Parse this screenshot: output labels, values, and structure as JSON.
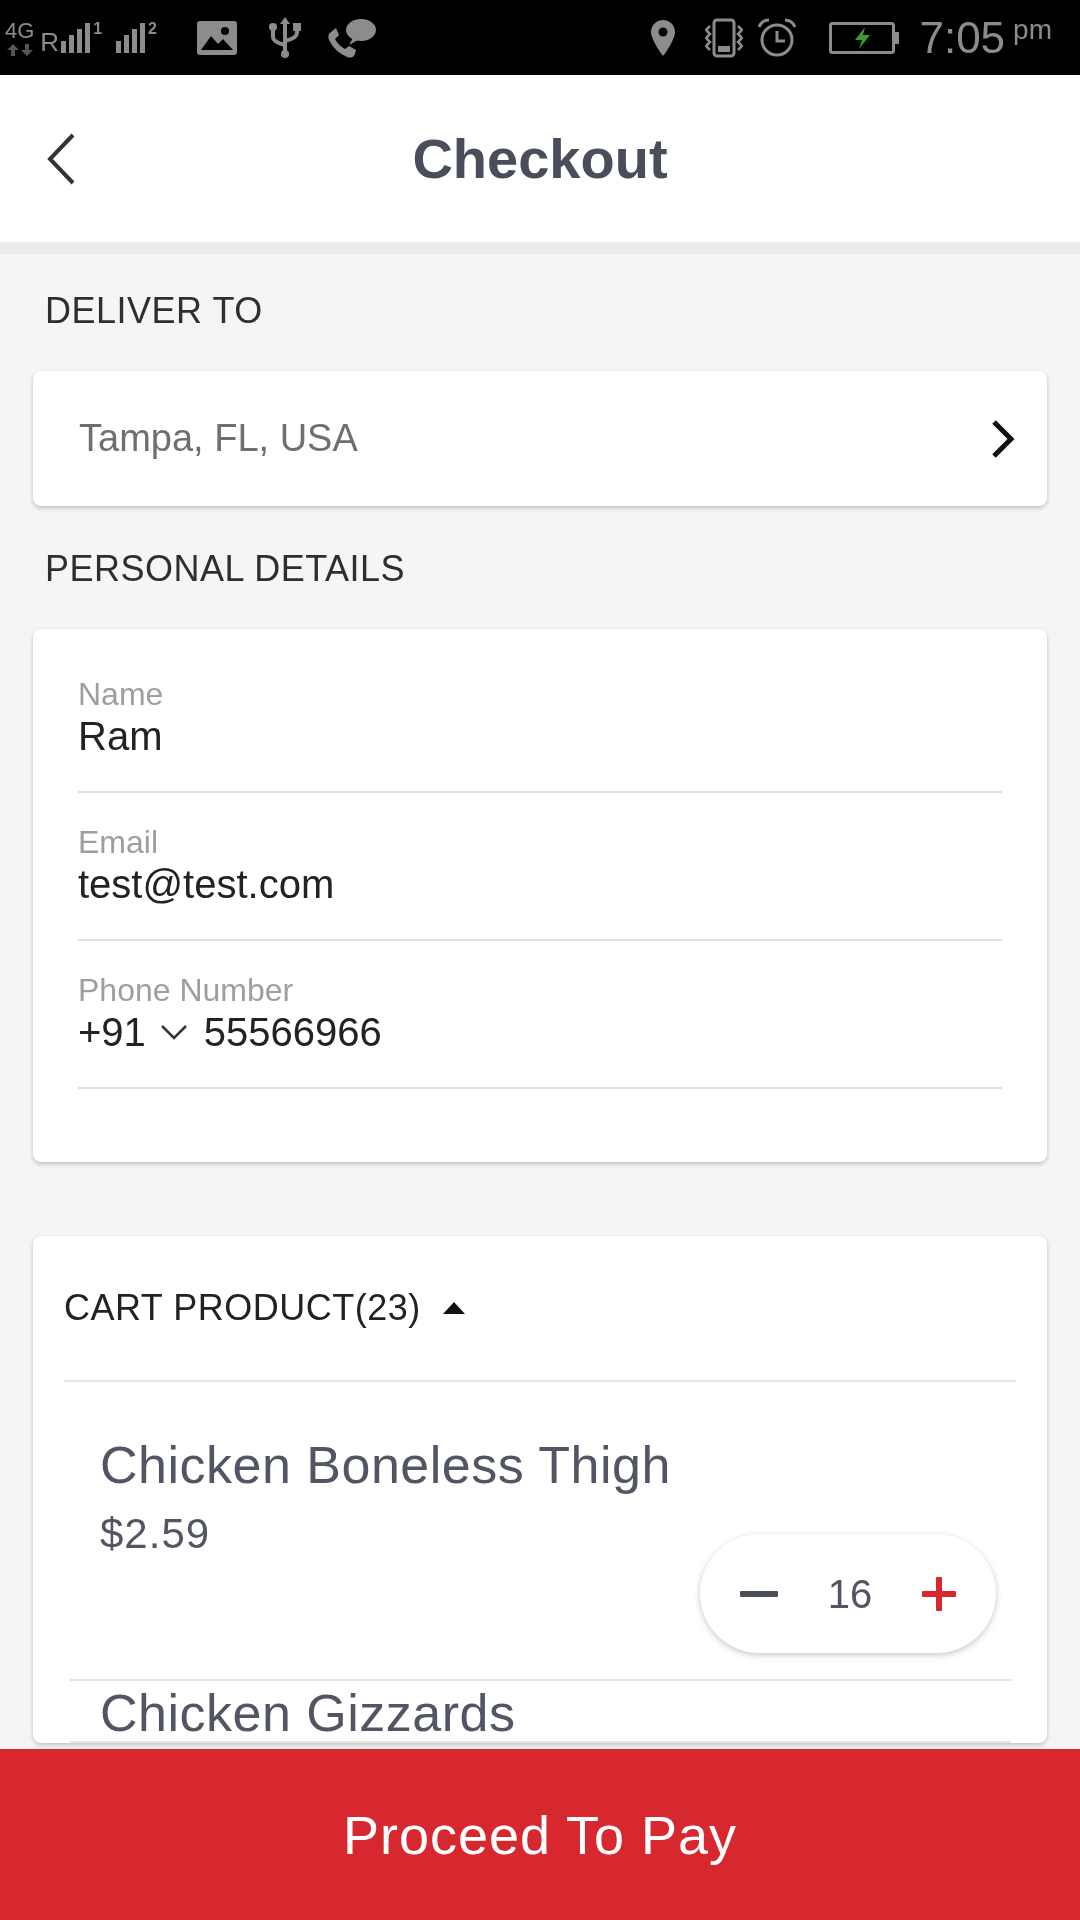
{
  "status_bar": {
    "network": "4G",
    "roaming": "R",
    "sim_slots": [
      "1",
      "2"
    ],
    "time": "7:05",
    "period": "pm"
  },
  "header": {
    "title": "Checkout"
  },
  "delivery": {
    "heading": "DELIVER TO",
    "address": "Tampa, FL, USA"
  },
  "personal_details": {
    "heading": "PERSONAL DETAILS",
    "fields": [
      {
        "kind": "text",
        "label": "Name",
        "value": "Ram"
      },
      {
        "kind": "text",
        "label": "Email",
        "value": "test@test.com"
      },
      {
        "kind": "phone",
        "label": "Phone Number",
        "country_code": "+91",
        "value": "55566966"
      }
    ]
  },
  "cart": {
    "heading": "CART PRODUCT(23)",
    "expanded": true,
    "items": [
      {
        "name": "Chicken Boneless Thigh",
        "price": "$2.59",
        "quantity": "16"
      },
      {
        "name": "Chicken Gizzards"
      }
    ]
  },
  "footer_button": {
    "label": "Proceed To Pay"
  }
}
